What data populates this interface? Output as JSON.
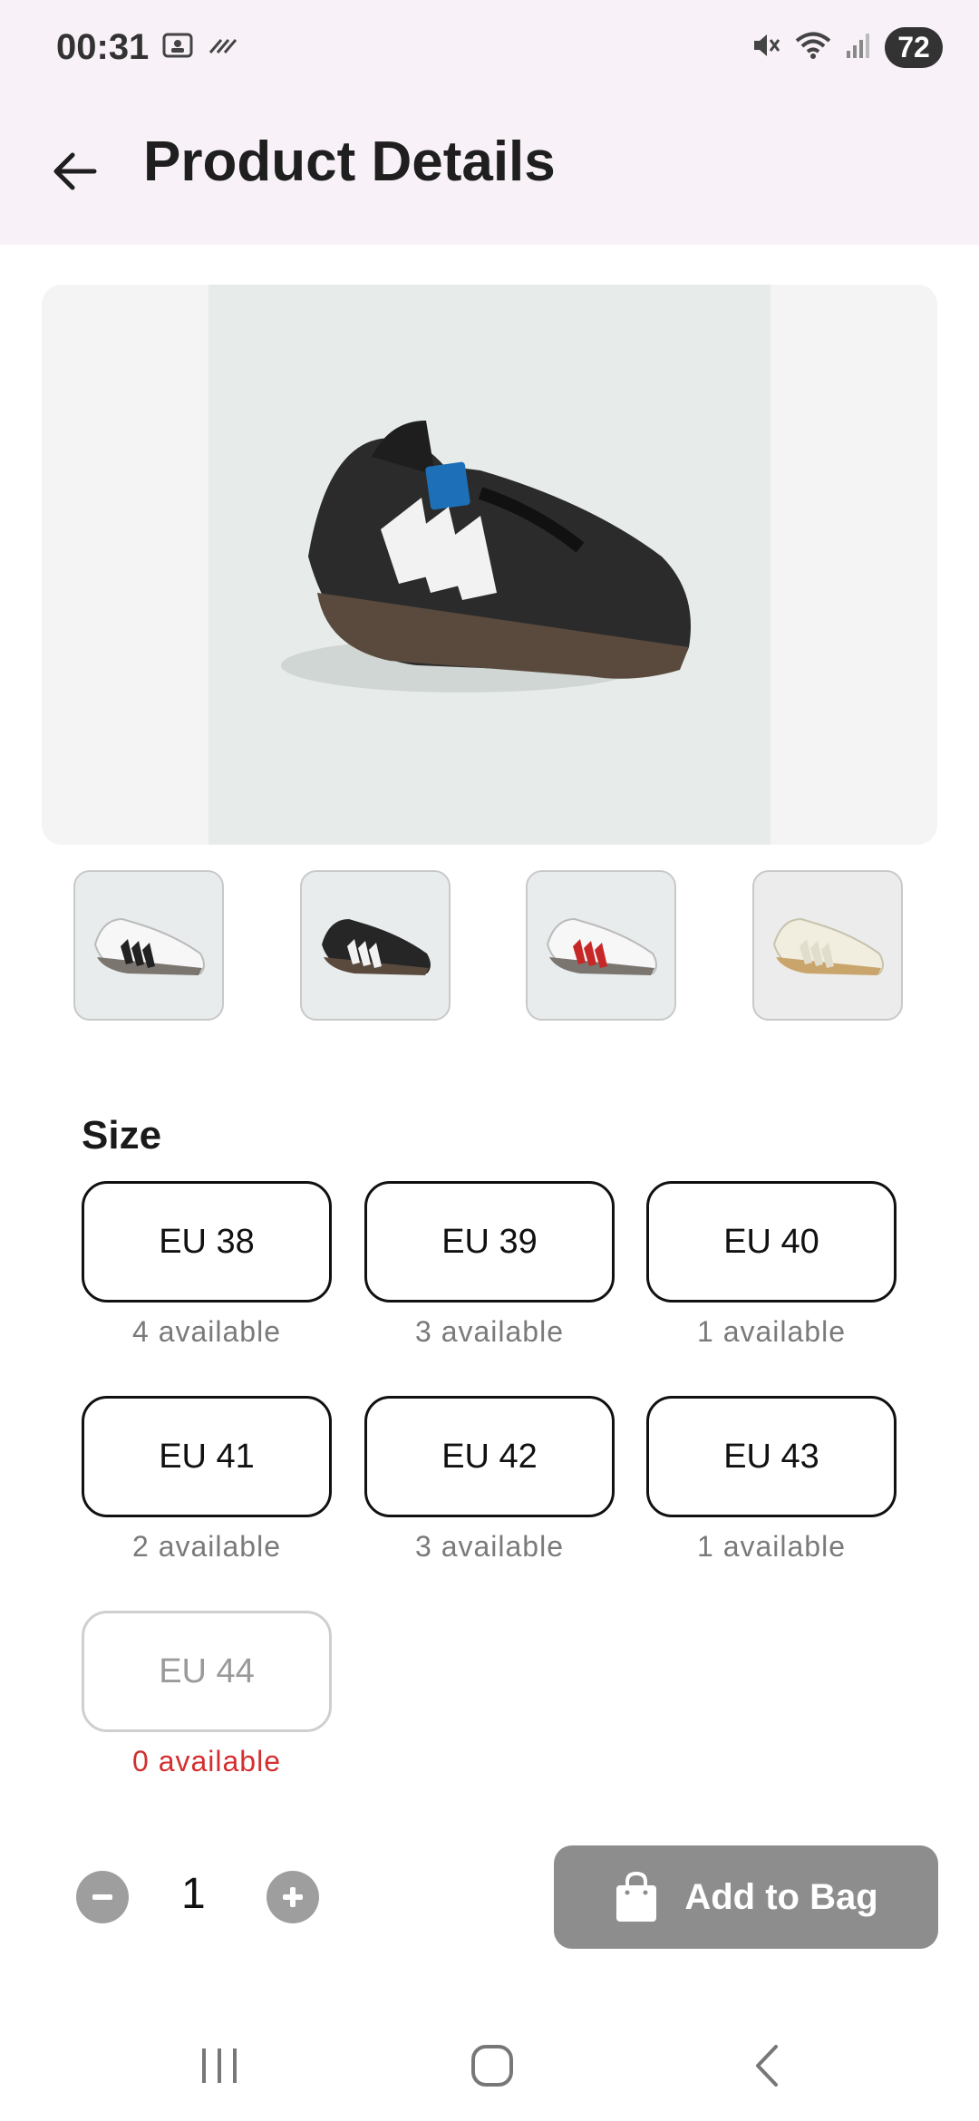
{
  "status": {
    "time": "00:31",
    "battery": "72"
  },
  "header": {
    "title": "Product Details"
  },
  "product": {
    "thumbnails": [
      {
        "name": "white-black-stripes"
      },
      {
        "name": "black-white-stripes"
      },
      {
        "name": "white-red-stripes"
      },
      {
        "name": "cream-white-stripes"
      }
    ]
  },
  "sizes": {
    "label": "Size",
    "options": [
      {
        "label": "EU 38",
        "availability": "4 available"
      },
      {
        "label": "EU 39",
        "availability": "3 available"
      },
      {
        "label": "EU 40",
        "availability": "1 available"
      },
      {
        "label": "EU 41",
        "availability": "2 available"
      },
      {
        "label": "EU 42",
        "availability": "3 available"
      },
      {
        "label": "EU 43",
        "availability": "1 available"
      },
      {
        "label": "EU 44",
        "availability": "0 available"
      }
    ]
  },
  "quantity": {
    "value": "1"
  },
  "cart": {
    "add_label": "Add to Bag"
  },
  "colors": {
    "accent_disabled": "#8d8d8d",
    "unavailable": "#d32f2f",
    "appbar": "#f8f1f7"
  }
}
